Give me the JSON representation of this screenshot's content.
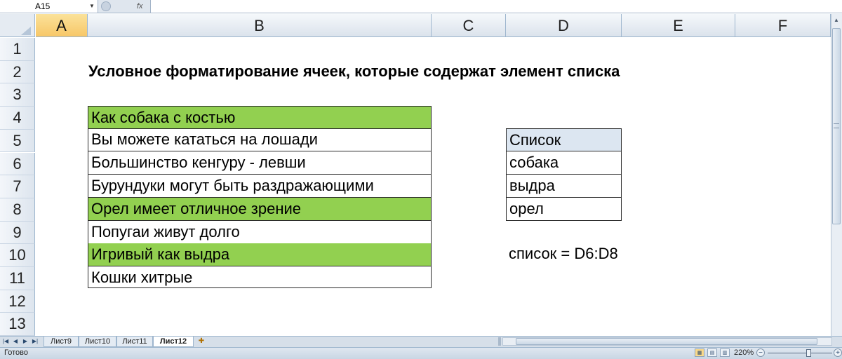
{
  "formula_bar": {
    "name_box": "A15",
    "fx_label": "fx",
    "formula": ""
  },
  "columns": [
    "A",
    "B",
    "C",
    "D",
    "E",
    "F"
  ],
  "selected_column": "A",
  "rows": [
    "1",
    "2",
    "3",
    "4",
    "5",
    "6",
    "7",
    "8",
    "9",
    "10",
    "11",
    "12",
    "13"
  ],
  "title": "Условное форматирование ячеек, которые содержат элемент списка",
  "phrases": [
    {
      "row": "4",
      "text": "Как собака с костью",
      "highlighted": true
    },
    {
      "row": "5",
      "text": "Вы можете кататься на лошади",
      "highlighted": false
    },
    {
      "row": "6",
      "text": "Большинство кенгуру - левши",
      "highlighted": false
    },
    {
      "row": "7",
      "text": "Бурундуки могут быть раздражающими",
      "highlighted": false
    },
    {
      "row": "8",
      "text": "Орел имеет отличное зрение",
      "highlighted": true
    },
    {
      "row": "9",
      "text": "Попугаи живут долго",
      "highlighted": false
    },
    {
      "row": "10",
      "text": "Игривый как выдра",
      "highlighted": true
    },
    {
      "row": "11",
      "text": "Кошки хитрые",
      "highlighted": false
    }
  ],
  "list_table": {
    "header": "Список",
    "items": [
      "собака",
      "выдра",
      "орел"
    ]
  },
  "formula_note": "список = D6:D8",
  "sheet_tabs": [
    "Лист9",
    "Лист10",
    "Лист11",
    "Лист12"
  ],
  "active_tab": "Лист12",
  "status": {
    "mode": "Готово",
    "zoom": "220%"
  },
  "colors": {
    "highlight": "#92d050",
    "list_header": "#dce6f1",
    "selected_header": "#f7c768"
  }
}
